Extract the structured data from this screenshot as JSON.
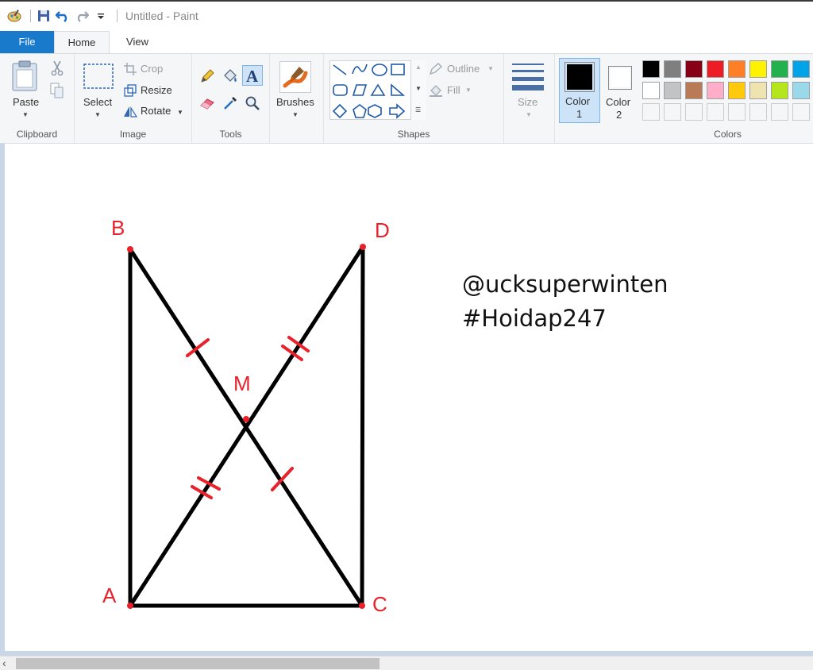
{
  "window": {
    "title": "Untitled - Paint"
  },
  "tabs": {
    "file": "File",
    "home": "Home",
    "view": "View"
  },
  "groups": {
    "clipboard": {
      "label": "Clipboard",
      "paste": "Paste"
    },
    "image": {
      "label": "Image",
      "select": "Select",
      "crop": "Crop",
      "resize": "Resize",
      "rotate": "Rotate"
    },
    "tools": {
      "label": "Tools"
    },
    "brushes": {
      "label": "Brushes"
    },
    "shapes": {
      "label": "Shapes",
      "outline": "Outline",
      "fill": "Fill"
    },
    "size": {
      "label": "Size"
    },
    "color1": {
      "line1": "Color",
      "line2": "1",
      "value": "#000000"
    },
    "color2": {
      "line1": "Color",
      "line2": "2",
      "value": "#ffffff"
    },
    "colors": {
      "label": "Colors"
    }
  },
  "palette": {
    "row1": [
      "#000000",
      "#7f7f7f",
      "#880015",
      "#ed1c24",
      "#ff7f27",
      "#fff200",
      "#22b14c",
      "#00a2e8"
    ],
    "row2": [
      "#ffffff",
      "#c3c3c3",
      "#b97a57",
      "#ffaec9",
      "#ffc90e",
      "#efe4b0",
      "#b5e61d",
      "#99d9ea"
    ],
    "row3": [
      "#f5f6f7",
      "#f5f6f7",
      "#f5f6f7",
      "#f5f6f7",
      "#f5f6f7",
      "#f5f6f7",
      "#f5f6f7",
      "#f5f6f7"
    ]
  },
  "canvas": {
    "points": {
      "A": "A",
      "B": "B",
      "C": "C",
      "D": "D",
      "M": "M"
    },
    "text_line1": "@ucksuperwinten",
    "text_line2": "#Hoidap247",
    "stroke_color": "#000000",
    "mark_color": "#e8212a"
  }
}
